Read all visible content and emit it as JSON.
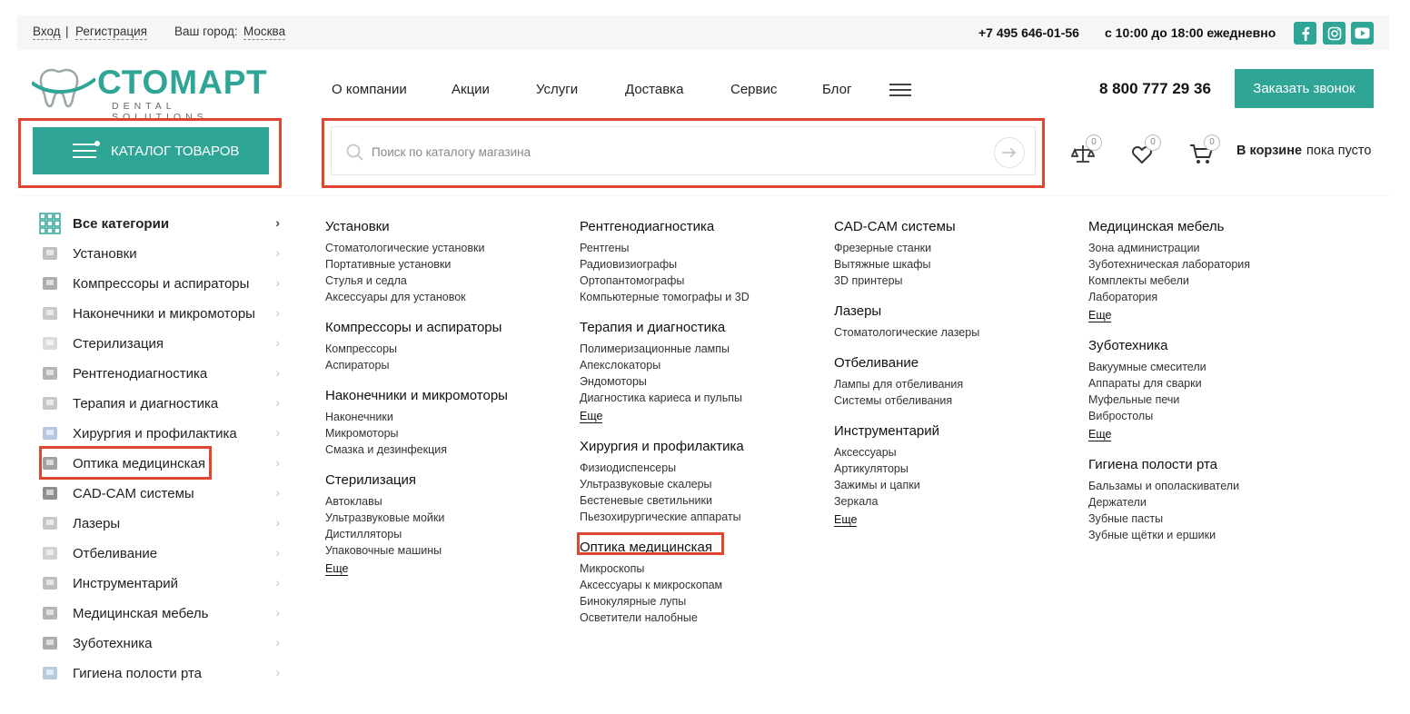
{
  "topbar": {
    "login": "Вход",
    "separator": "|",
    "register": "Регистрация",
    "city_label": "Ваш город:",
    "city": "Москва",
    "phone": "+7 495 646-01-56",
    "hours": "с 10:00 до 18:00 ежедневно",
    "social": [
      "facebook-icon",
      "instagram-icon",
      "youtube-icon"
    ]
  },
  "logo": {
    "name": "СТОМАРТ",
    "tagline": "DENTAL SOLUTIONS"
  },
  "nav": [
    "О компании",
    "Акции",
    "Услуги",
    "Доставка",
    "Сервис",
    "Блог"
  ],
  "header": {
    "phone": "8 800 777 29 36",
    "call_button": "Заказать звонок",
    "catalog_button": "КАТАЛОГ ТОВАРОВ",
    "search_placeholder": "Поиск по каталогу магазина",
    "compare_count": "0",
    "favorites_count": "0",
    "cart_count": "0",
    "cart_label": "В корзине",
    "cart_status": "пока пусто"
  },
  "sidebar": [
    "Все категории",
    "Установки",
    "Компрессоры и аспираторы",
    "Наконечники и микромоторы",
    "Стерилизация",
    "Рентгенодиагностика",
    "Терапия и диагностика",
    "Хирургия и профилактика",
    "Оптика медицинская",
    "CAD-CAM системы",
    "Лазеры",
    "Отбеливание",
    "Инструментарий",
    "Медицинская мебель",
    "Зуботехника",
    "Гигиена полости рта"
  ],
  "more_label": "Еще",
  "columns": [
    [
      {
        "title": "Установки",
        "items": [
          "Стоматологические установки",
          "Портативные установки",
          "Стулья и седла",
          "Аксессуары для установок"
        ],
        "more": false
      },
      {
        "title": "Компрессоры и аспираторы",
        "items": [
          "Компрессоры",
          "Аспираторы"
        ],
        "more": false
      },
      {
        "title": "Наконечники и микромоторы",
        "items": [
          "Наконечники",
          "Микромоторы",
          "Смазка и дезинфекция"
        ],
        "more": false
      },
      {
        "title": "Стерилизация",
        "items": [
          "Автоклавы",
          "Ультразвуковые мойки",
          "Дистилляторы",
          "Упаковочные машины"
        ],
        "more": true
      }
    ],
    [
      {
        "title": "Рентгенодиагностика",
        "items": [
          "Рентгены",
          "Радиовизиографы",
          "Ортопантомографы",
          "Компьютерные томографы и 3D"
        ],
        "more": false
      },
      {
        "title": "Терапия и диагностика",
        "items": [
          "Полимеризационные лампы",
          "Апекслокаторы",
          "Эндомоторы",
          "Диагностика кариеса и пульпы"
        ],
        "more": true
      },
      {
        "title": "Хирургия и профилактика",
        "items": [
          "Физиодиспенсеры",
          "Ультразвуковые скалеры",
          "Бестеневые светильники",
          "Пьезохирургические аппараты"
        ],
        "more": false
      },
      {
        "title": "Оптика медицинская",
        "items": [
          "Микроскопы",
          "Аксессуары к микроскопам",
          "Бинокулярные лупы",
          "Осветители налобные"
        ],
        "more": false
      }
    ],
    [
      {
        "title": "CAD-CAM системы",
        "items": [
          "Фрезерные станки",
          "Вытяжные шкафы",
          "3D принтеры"
        ],
        "more": false
      },
      {
        "title": "Лазеры",
        "items": [
          "Стоматологические лазеры"
        ],
        "more": false
      },
      {
        "title": "Отбеливание",
        "items": [
          "Лампы для отбеливания",
          "Системы отбеливания"
        ],
        "more": false
      },
      {
        "title": "Инструментарий",
        "items": [
          "Аксессуары",
          "Артикуляторы",
          "Зажимы и цапки",
          "Зеркала"
        ],
        "more": true
      }
    ],
    [
      {
        "title": "Медицинская мебель",
        "items": [
          "Зона администрации",
          "Зуботехническая лаборатория",
          "Комплекты мебели",
          "Лаборатория"
        ],
        "more": true
      },
      {
        "title": "Зуботехника",
        "items": [
          "Вакуумные смесители",
          "Аппараты для сварки",
          "Муфельные печи",
          "Вибростолы"
        ],
        "more": true
      },
      {
        "title": "Гигиена полости рта",
        "items": [
          "Бальзамы и ополаскиватели",
          "Держатели",
          "Зубные пасты",
          "Зубные щётки и ершики"
        ],
        "more": false
      }
    ]
  ],
  "colors": {
    "accent": "#2ea595",
    "highlight": "#e0452f"
  }
}
